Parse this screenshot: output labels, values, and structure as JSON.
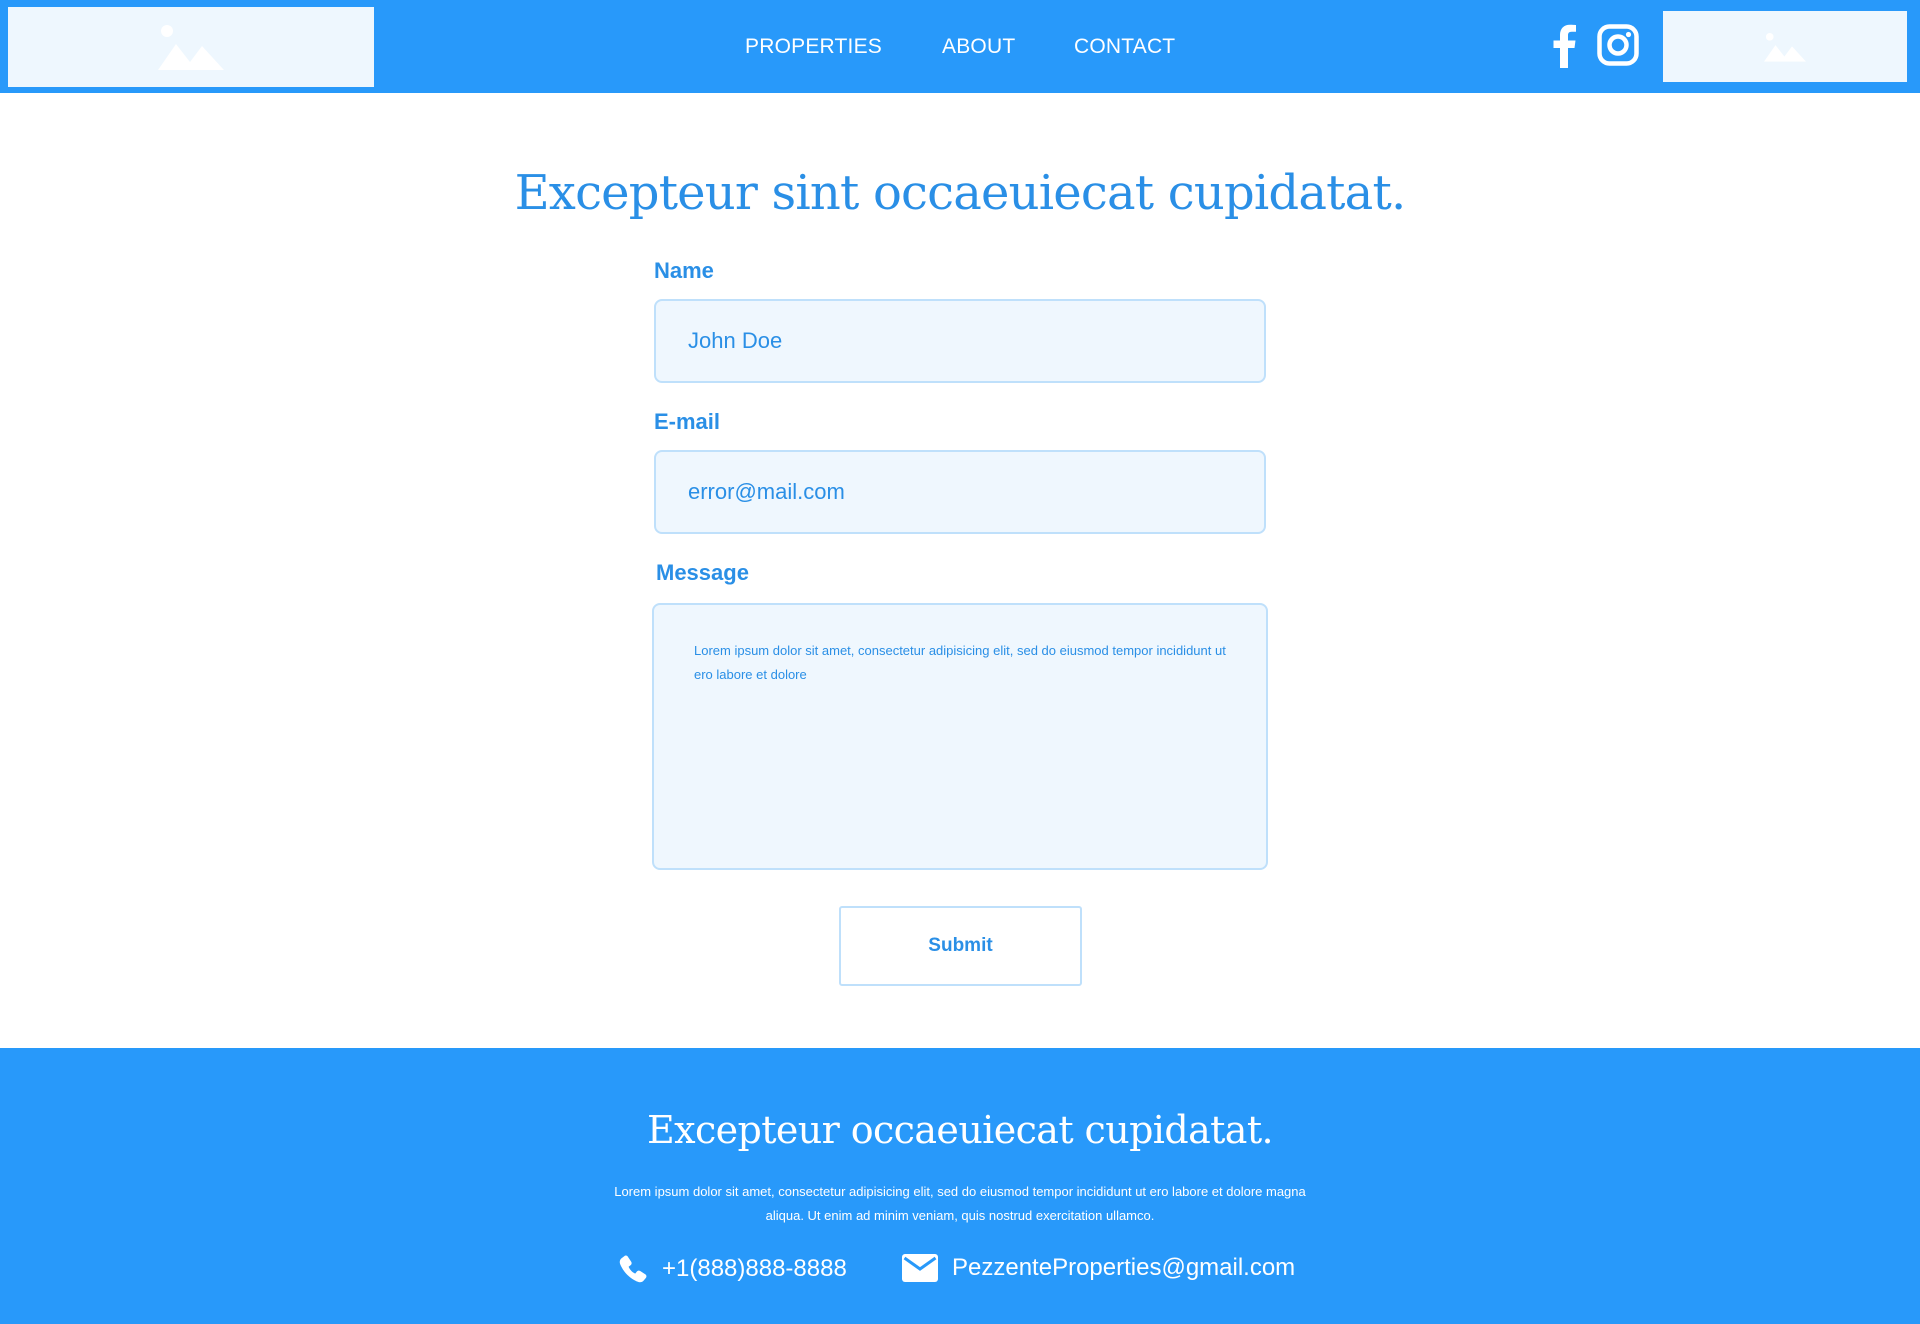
{
  "header": {
    "nav": [
      {
        "label": "PROPERTIES"
      },
      {
        "label": "ABOUT"
      },
      {
        "label": "CONTACT"
      }
    ],
    "social_icons": [
      "facebook-icon",
      "instagram-icon"
    ]
  },
  "main": {
    "title": "Excepteur sint occaeuiecat cupidatat.",
    "form": {
      "name_label": "Name",
      "name_value": "John Doe",
      "email_label": "E-mail",
      "email_value": "error@mail.com",
      "message_label": "Message",
      "message_value": "Lorem ipsum dolor sit amet, consectetur adipisicing elit, sed do eiusmod tempor incididunt ut ero labore et dolore",
      "submit_label": "Submit"
    }
  },
  "footer": {
    "title": "Excepteur occaeuiecat cupidatat.",
    "text": "Lorem ipsum dolor sit amet, consectetur adipisicing elit, sed do eiusmod tempor incididunt ut ero labore et dolore magna aliqua. Ut enim ad minim veniam, quis nostrud exercitation ullamco.",
    "phone": "+1(888)888-8888",
    "email": "PezzenteProperties@gmail.com"
  },
  "colors": {
    "brand_blue": "#2899fa",
    "text_blue": "#2a8fe6",
    "field_bg": "#eff7fe",
    "field_border": "#bfe0fb"
  }
}
